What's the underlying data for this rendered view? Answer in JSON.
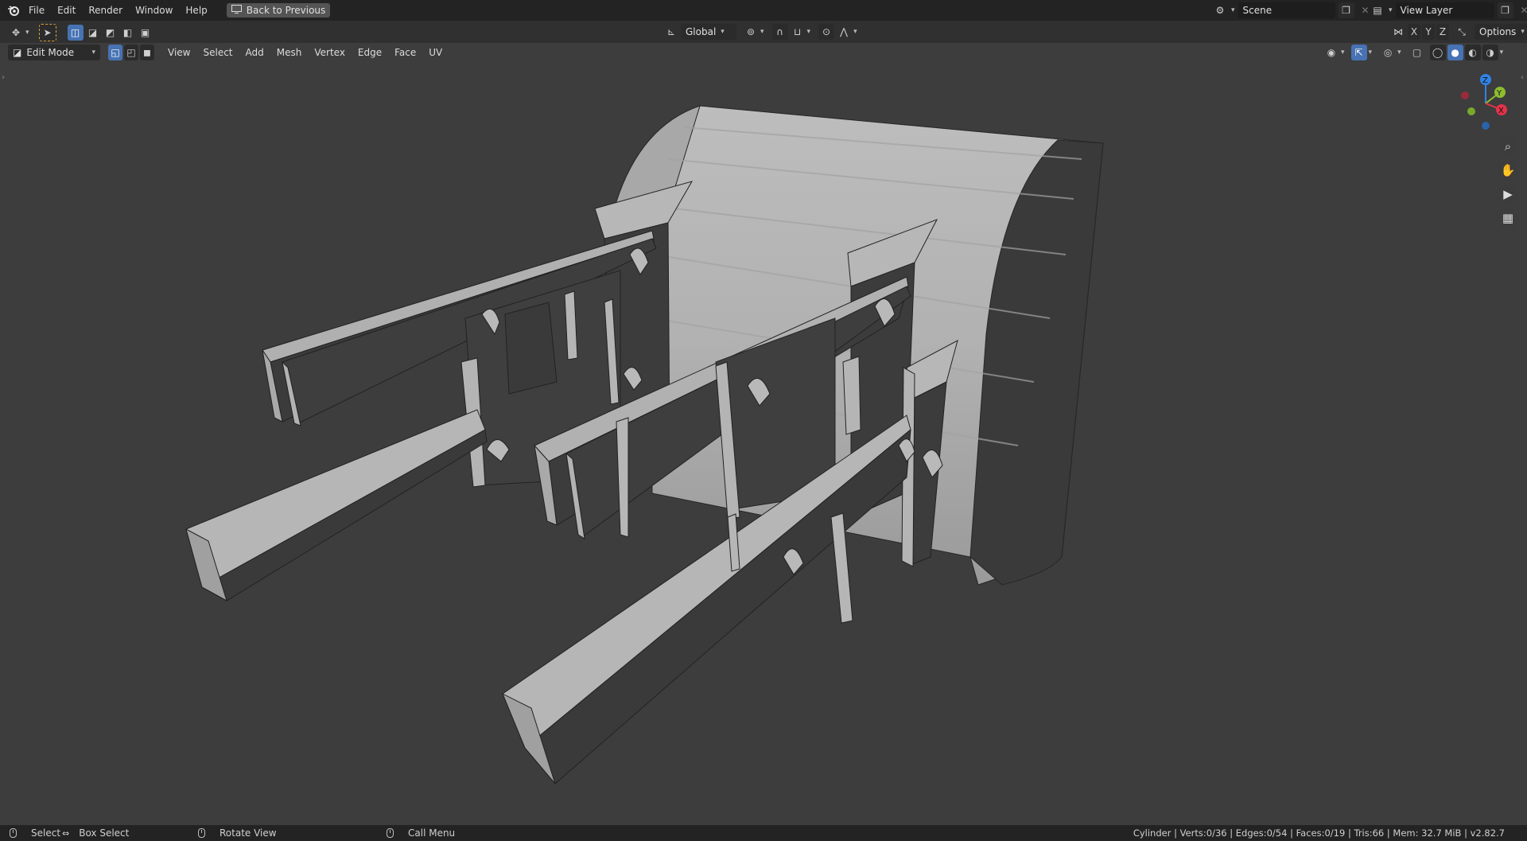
{
  "topbar": {
    "menus": [
      "File",
      "Edit",
      "Render",
      "Window",
      "Help"
    ],
    "back_button": "Back to Previous",
    "scene": "Scene",
    "view_layer": "View Layer"
  },
  "header": {
    "transform_orientation": "Global",
    "axis_labels": [
      "X",
      "Y",
      "Z"
    ],
    "options_label": "Options"
  },
  "viewport_header": {
    "mode": "Edit Mode",
    "menus": [
      "View",
      "Select",
      "Add",
      "Mesh",
      "Vertex",
      "Edge",
      "Face",
      "UV"
    ]
  },
  "gizmo": {
    "z": "Z",
    "y": "Y",
    "x": "X"
  },
  "statusbar": {
    "select": "Select",
    "box_select": "Box Select",
    "rotate_view": "Rotate View",
    "call_menu": "Call Menu",
    "stats": "Cylinder | Verts:0/36 | Edges:0/54 | Faces:0/19 | Tris:66 | Mem: 32.7 MiB | v2.82.7"
  },
  "colors": {
    "background": "#3d3d3d",
    "accent": "#4772b3",
    "mesh_light": "#b4b4b4",
    "mesh_dark": "#3e3e3e"
  }
}
